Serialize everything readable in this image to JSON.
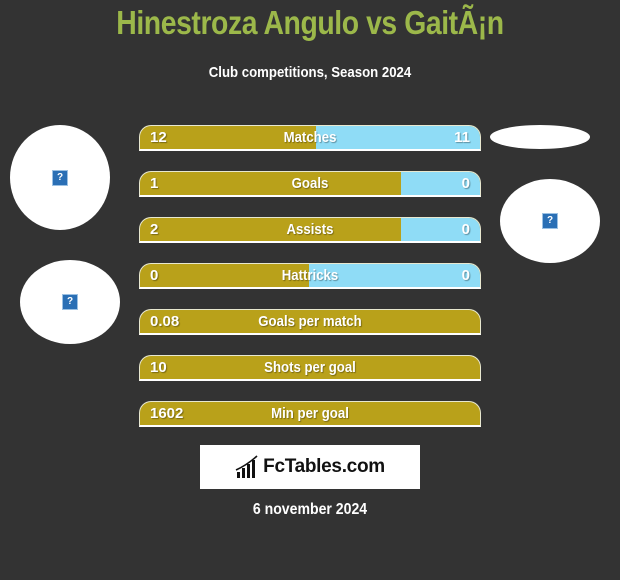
{
  "header": {
    "title": "Hinestroza Angulo vs GaitÃ¡n",
    "subtitle": "Club competitions, Season 2024"
  },
  "colors": {
    "background": "#333333",
    "title": "#9cb84a",
    "left_bar": "#b9a11a",
    "right_bar": "#8fdcf6"
  },
  "avatars": [
    {
      "icon": "broken-image-icon",
      "glyph": "?"
    },
    {
      "icon": "broken-image-icon",
      "glyph": "?"
    },
    {
      "icon": "blank-avatar",
      "glyph": ""
    },
    {
      "icon": "broken-image-icon",
      "glyph": "?"
    }
  ],
  "stats": [
    {
      "label": "Matches",
      "left": "12",
      "right": "11",
      "left_share": 0.52
    },
    {
      "label": "Goals",
      "left": "1",
      "right": "0",
      "left_share": 0.77
    },
    {
      "label": "Assists",
      "left": "2",
      "right": "0",
      "left_share": 0.77
    },
    {
      "label": "Hattricks",
      "left": "0",
      "right": "0",
      "left_share": 0.5
    },
    {
      "label": "Goals per match",
      "left": "0.08",
      "right": "",
      "left_share": 1
    },
    {
      "label": "Shots per goal",
      "left": "10",
      "right": "",
      "left_share": 1
    },
    {
      "label": "Min per goal",
      "left": "1602",
      "right": "",
      "left_share": 1
    }
  ],
  "logo": {
    "text": "FcTables.com",
    "icon": "bar-chart-icon"
  },
  "footer": {
    "date": "6 november 2024"
  }
}
